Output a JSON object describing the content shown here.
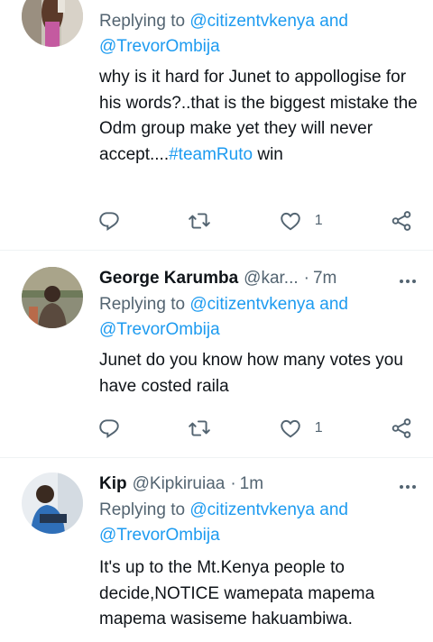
{
  "tweets": [
    {
      "name": "",
      "handle": "",
      "time": "",
      "replying_label": "Replying to",
      "replying_to_1": "@citizentvkenya",
      "replying_and": "and",
      "replying_to_2": "@TrevorOmbija",
      "text_parts": [
        "why is it hard for Junet to appollogise for his words?..that is the biggest mistake the Odm group make yet they will never accept....",
        "#teamRuto",
        " win"
      ],
      "likes": "1"
    },
    {
      "name": "George Karumba",
      "handle": "@kar...",
      "separator": "·",
      "time": "7m",
      "replying_label": "Replying to",
      "replying_to_1": "@citizentvkenya",
      "replying_and": "and",
      "replying_to_2": "@TrevorOmbija",
      "text": "Junet do you know how many votes you have costed raila",
      "likes": "1"
    },
    {
      "name": "Kip",
      "handle": "@Kipkiruiaa",
      "separator": "·",
      "time": "1m",
      "replying_label": "Replying to",
      "replying_to_1": "@citizentvkenya",
      "replying_and": "and",
      "replying_to_2": "@TrevorOmbija",
      "text": "It's up to the Mt.Kenya people to decide,NOTICE wamepata mapema mapema wasiseme hakuambiwa."
    }
  ],
  "icons": {
    "reply": "reply-icon",
    "retweet": "retweet-icon",
    "like": "heart-icon",
    "share": "share-icon",
    "more": "more-icon"
  },
  "colors": {
    "link": "#1d9bf0",
    "secondary": "#536471",
    "primary": "#0f1419",
    "divider": "#eff3f4"
  }
}
